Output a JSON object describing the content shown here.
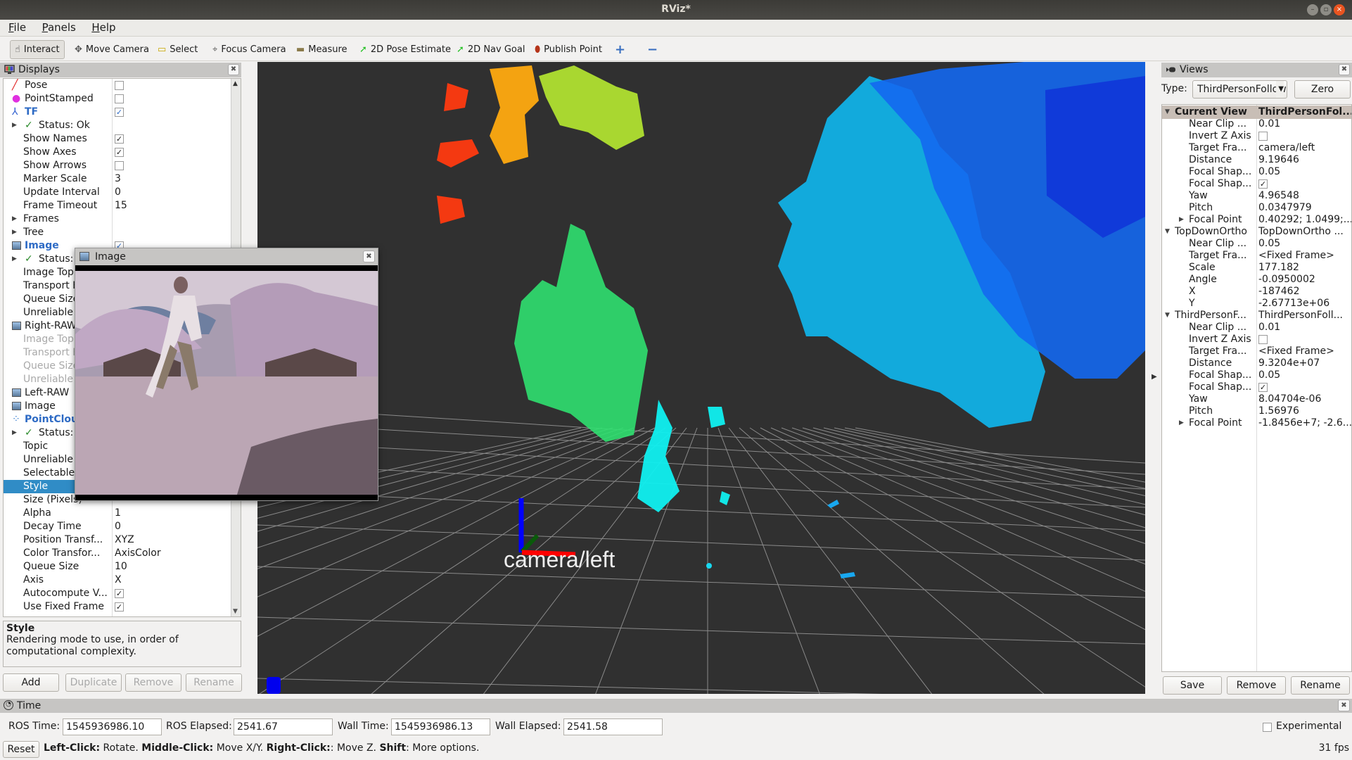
{
  "window": {
    "title": "RViz*",
    "controls": [
      "minimize",
      "maximize",
      "close"
    ]
  },
  "menu": [
    "File",
    "Panels",
    "Help"
  ],
  "toolbar": {
    "tools": [
      {
        "label": "Interact",
        "icon": "hand-pointer-icon",
        "glyph": "☝",
        "active": true
      },
      {
        "label": "Move Camera",
        "icon": "move-camera-icon",
        "glyph": "✥"
      },
      {
        "label": "Select",
        "icon": "select-box-icon",
        "glyph": "▭"
      },
      {
        "label": "Focus Camera",
        "icon": "focus-camera-icon",
        "glyph": "⌖"
      },
      {
        "label": "Measure",
        "icon": "ruler-icon",
        "glyph": "▬"
      },
      {
        "label": "2D Pose Estimate",
        "icon": "green-arrow-icon",
        "glyph": "➚"
      },
      {
        "label": "2D Nav Goal",
        "icon": "green-arrow-icon",
        "glyph": "➚"
      },
      {
        "label": "Publish Point",
        "icon": "map-pin-icon",
        "glyph": "⬮"
      }
    ],
    "add_tool_glyph": "+",
    "remove_tool_glyph": "−"
  },
  "displays": {
    "title": "Displays",
    "rows": [
      {
        "label": "Pose",
        "icon": "pose-arrow-icon",
        "glyph": "╱",
        "check": false,
        "level": 0
      },
      {
        "label": "PointStamped",
        "icon": "point-icon",
        "glyph": "●",
        "check": false,
        "level": 0
      },
      {
        "label": "TF",
        "icon": "tf-axes-icon",
        "glyph": "⅄",
        "check": true,
        "level": 0,
        "blue": true
      },
      {
        "label": "Status: Ok",
        "status": true,
        "expand": true,
        "level": 1
      },
      {
        "label": "Show Names",
        "check": true,
        "level": 1
      },
      {
        "label": "Show Axes",
        "check": true,
        "level": 1
      },
      {
        "label": "Show Arrows",
        "check": false,
        "level": 1
      },
      {
        "label": "Marker Scale",
        "value": "3",
        "level": 1
      },
      {
        "label": "Update Interval",
        "value": "0",
        "level": 1
      },
      {
        "label": "Frame Timeout",
        "value": "15",
        "level": 1
      },
      {
        "label": "Frames",
        "expand": true,
        "level": 1
      },
      {
        "label": "Tree",
        "expand": true,
        "level": 1
      },
      {
        "label": "Image",
        "icon": "image-icon",
        "check": true,
        "level": 0,
        "blue": true
      },
      {
        "label": "Status: Ok",
        "status": true,
        "expand": true,
        "level": 1
      },
      {
        "label": "Image Topic",
        "level": 1
      },
      {
        "label": "Transport Hint",
        "level": 1
      },
      {
        "label": "Queue Size",
        "level": 1
      },
      {
        "label": "Unreliable",
        "level": 1
      },
      {
        "label": "Right-RAW",
        "icon": "image-icon",
        "level": 0
      },
      {
        "label": "Image Topic",
        "level": 1,
        "disabled": true
      },
      {
        "label": "Transport Hint",
        "level": 1,
        "disabled": true
      },
      {
        "label": "Queue Size",
        "level": 1,
        "disabled": true
      },
      {
        "label": "Unreliable",
        "level": 1,
        "disabled": true
      },
      {
        "label": "Left-RAW",
        "icon": "image-icon",
        "level": 0
      },
      {
        "label": "Image",
        "icon": "image-icon",
        "level": 0
      },
      {
        "label": "PointCloud2",
        "icon": "pointcloud-icon",
        "glyph": "⁘",
        "level": 0,
        "blue": true
      },
      {
        "label": "Status: Ok",
        "status": true,
        "expand": true,
        "level": 1
      },
      {
        "label": "Topic",
        "level": 1
      },
      {
        "label": "Unreliable",
        "level": 1
      },
      {
        "label": "Selectable",
        "level": 1
      },
      {
        "label": "Style",
        "level": 1,
        "selected": true
      },
      {
        "label": "Size (Pixels)",
        "level": 1
      },
      {
        "label": "Alpha",
        "value": "1",
        "level": 1
      },
      {
        "label": "Decay Time",
        "value": "0",
        "level": 1
      },
      {
        "label": "Position Transf...",
        "value": "XYZ",
        "level": 1
      },
      {
        "label": "Color Transfor...",
        "value": "AxisColor",
        "level": 1
      },
      {
        "label": "Queue Size",
        "value": "10",
        "level": 1
      },
      {
        "label": "Axis",
        "value": "X",
        "level": 1
      },
      {
        "label": "Autocompute V...",
        "check": true,
        "level": 1
      },
      {
        "label": "Use Fixed Frame",
        "check": true,
        "level": 1
      }
    ],
    "description_title": "Style",
    "description_text": "Rendering mode to use, in order of computational complexity.",
    "buttons": {
      "add": "Add",
      "duplicate": "Duplicate",
      "remove": "Remove",
      "rename": "Rename"
    }
  },
  "image_window": {
    "title": "Image"
  },
  "viewport": {
    "frame_label": "camera/left",
    "colors": {
      "background": "#303030",
      "grid": "#a0a0a0",
      "x_axis": "#ff0000",
      "y_axis": "#00aa00",
      "z_axis": "#0000ff"
    }
  },
  "views": {
    "title": "Views",
    "type_label": "Type:",
    "type_value": "ThirdPersonFollower",
    "zero_button": "Zero",
    "rows": [
      {
        "label": "Current View",
        "value": "ThirdPersonFol...",
        "level": 0,
        "header": true,
        "expand": "open"
      },
      {
        "label": "Near Clip ...",
        "value": "0.01",
        "level": 1
      },
      {
        "label": "Invert Z Axis",
        "check": false,
        "level": 1
      },
      {
        "label": "Target Fra...",
        "value": "camera/left",
        "level": 1
      },
      {
        "label": "Distance",
        "value": "9.19646",
        "level": 1
      },
      {
        "label": "Focal Shap...",
        "value": "0.05",
        "level": 1
      },
      {
        "label": "Focal Shap...",
        "check": true,
        "level": 1
      },
      {
        "label": "Yaw",
        "value": "4.96548",
        "level": 1
      },
      {
        "label": "Pitch",
        "value": "0.0347979",
        "level": 1
      },
      {
        "label": "Focal Point",
        "value": "0.40292; 1.0499;...",
        "level": 1,
        "expand": "closed"
      },
      {
        "label": "TopDownOrtho",
        "value": "TopDownOrtho ...",
        "level": 0,
        "expand": "open"
      },
      {
        "label": "Near Clip ...",
        "value": "0.05",
        "level": 1
      },
      {
        "label": "Target Fra...",
        "value": "<Fixed Frame>",
        "level": 1
      },
      {
        "label": "Scale",
        "value": "177.182",
        "level": 1
      },
      {
        "label": "Angle",
        "value": "-0.0950002",
        "level": 1
      },
      {
        "label": "X",
        "value": "-187462",
        "level": 1
      },
      {
        "label": "Y",
        "value": "-2.67713e+06",
        "level": 1
      },
      {
        "label": "ThirdPersonF...",
        "value": "ThirdPersonFoll...",
        "level": 0,
        "expand": "open"
      },
      {
        "label": "Near Clip ...",
        "value": "0.01",
        "level": 1
      },
      {
        "label": "Invert Z Axis",
        "check": false,
        "level": 1
      },
      {
        "label": "Target Fra...",
        "value": "<Fixed Frame>",
        "level": 1
      },
      {
        "label": "Distance",
        "value": "9.3204e+07",
        "level": 1
      },
      {
        "label": "Focal Shap...",
        "value": "0.05",
        "level": 1
      },
      {
        "label": "Focal Shap...",
        "check": true,
        "level": 1
      },
      {
        "label": "Yaw",
        "value": "8.04704e-06",
        "level": 1
      },
      {
        "label": "Pitch",
        "value": "1.56976",
        "level": 1
      },
      {
        "label": "Focal Point",
        "value": "-1.8456e+7; -2.6...",
        "level": 1,
        "expand": "closed"
      }
    ],
    "buttons": {
      "save": "Save",
      "remove": "Remove",
      "rename": "Rename"
    }
  },
  "time": {
    "title": "Time",
    "ros_time_label": "ROS Time:",
    "ros_time": "1545936986.10",
    "ros_elapsed_label": "ROS Elapsed:",
    "ros_elapsed": "2541.67",
    "wall_time_label": "Wall Time:",
    "wall_time": "1545936986.13",
    "wall_elapsed_label": "Wall Elapsed:",
    "wall_elapsed": "2541.58",
    "experimental_label": "Experimental",
    "experimental": false
  },
  "status": {
    "reset": "Reset",
    "hints": [
      {
        "key": "Left-Click:",
        "text": " Rotate. "
      },
      {
        "key": "Middle-Click:",
        "text": " Move X/Y. "
      },
      {
        "key": "Right-Click:",
        "text": ": Move Z. "
      },
      {
        "key": "Shift",
        "text": ": More options."
      }
    ],
    "fps": "31 fps"
  }
}
